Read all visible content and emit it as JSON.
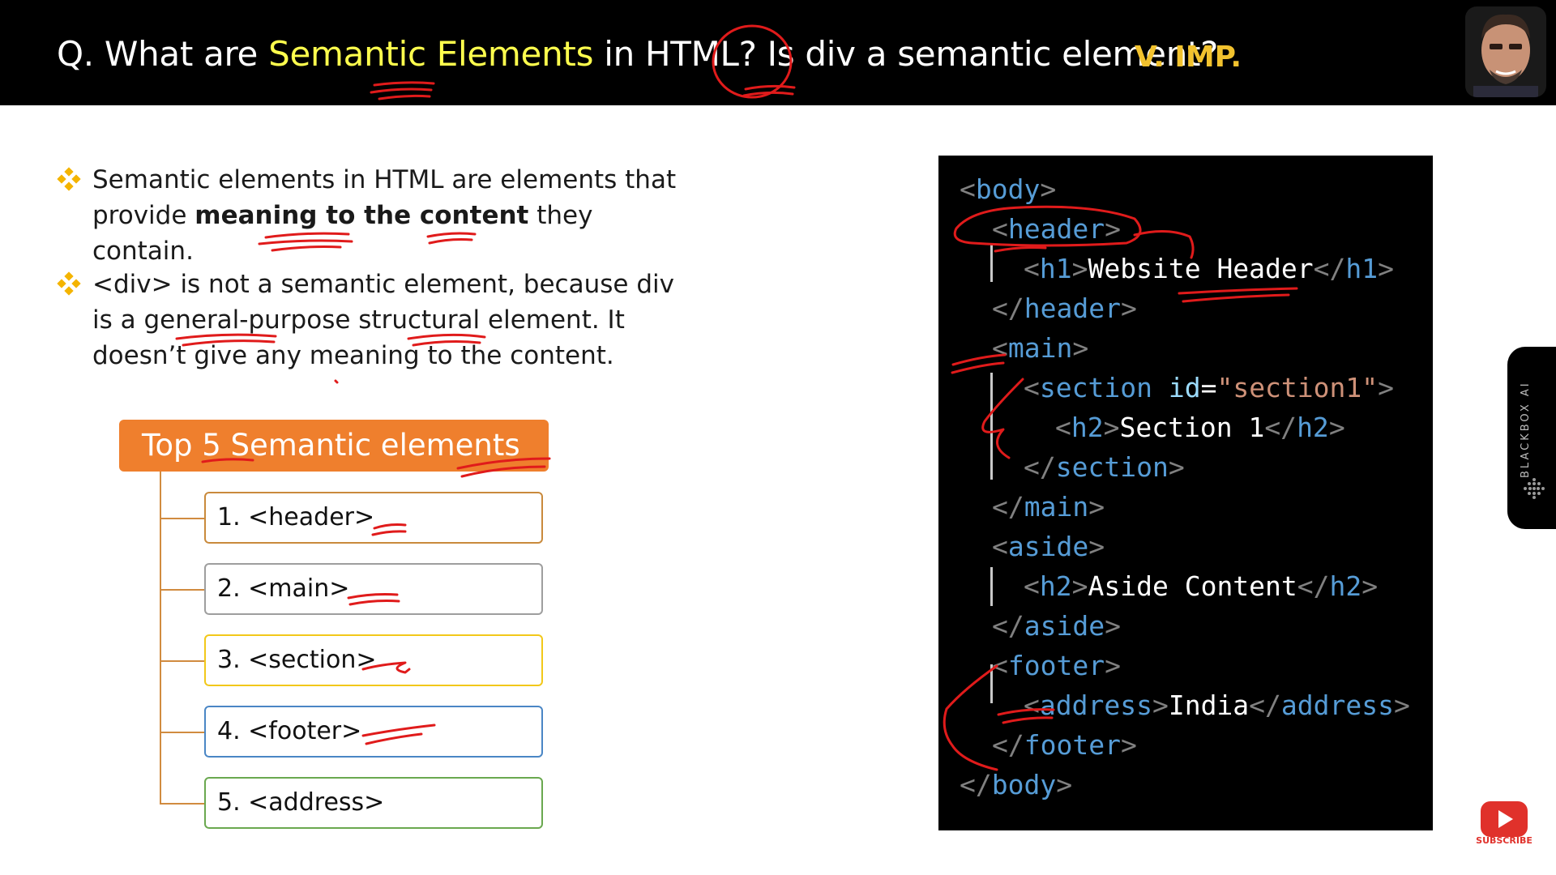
{
  "header": {
    "q_prefix": "Q. What are ",
    "q_highlight": "Semantic Elements",
    "q_suffix": " in HTML? Is div a semantic element?",
    "importance": "V. IMP."
  },
  "bullets": {
    "b1_part1": "Semantic elements in HTML are elements that provide ",
    "b1_bold": "meaning to the content",
    "b1_part2": " they contain.",
    "b2_text": "<div> is not a semantic element, because div is a general-purpose structural element. It doesn’t give any meaning to the content."
  },
  "top5": {
    "title": "Top 5 Semantic elements",
    "items": [
      "1. <header>",
      "2. <main>",
      "3. <section>",
      "4. <footer>",
      "5. <address>"
    ]
  },
  "code": {
    "body_open": "body",
    "header_open": "header",
    "h1_tag": "h1",
    "h1_text": "Website Header",
    "header_close": "header",
    "main_open": "main",
    "section_tag": "section",
    "section_attr": "id",
    "section_attr_val": "\"section1\"",
    "h2_tag": "h2",
    "h2_text": "Section 1",
    "section_close": "section",
    "main_close": "main",
    "aside_open": "aside",
    "aside_h2_text": "Aside Content",
    "aside_close": "aside",
    "footer_open": "footer",
    "address_tag": "address",
    "address_text": "India",
    "footer_close": "footer",
    "body_close": "body"
  },
  "widgets": {
    "blackbox_label": "BLACKBOX AI",
    "subscribe_label": "SUBSCRIBE"
  },
  "colors": {
    "title_highlight": "#ffff4d",
    "importance": "#f2c22e",
    "top5_bg": "#ef7f2d",
    "ink": "#e01b1b",
    "box_borders": [
      "#c98a3c",
      "#9e9e9e",
      "#f2c81a",
      "#4a86c5",
      "#6aa84f"
    ]
  }
}
